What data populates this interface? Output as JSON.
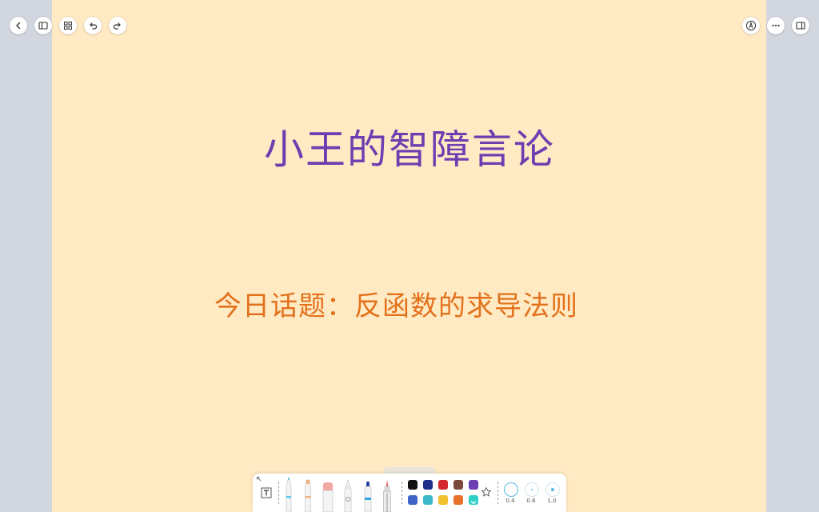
{
  "page": {
    "title": "小王的智障言论",
    "subtitle": "今日话题：反函数的求导法则"
  },
  "top_toolbar": {
    "left": [
      "back-icon",
      "sidebar-icon",
      "grid-icon",
      "undo-icon",
      "redo-icon"
    ],
    "right": [
      "pen-mode-icon",
      "more-icon",
      "panel-icon"
    ]
  },
  "pen_toolbar": {
    "tools": [
      "text-box-icon",
      "pen-icon",
      "highlighter-icon",
      "eraser-icon",
      "lasso-icon",
      "marker-icon",
      "fine-pen-icon"
    ],
    "colors": [
      "#111111",
      "#1c2f8a",
      "#d6262e",
      "#7a4a3a",
      "#6a3fb3",
      "#3f63c8",
      "#3bb8c8",
      "#f2c22e",
      "#e8702a",
      "#2ed0c8"
    ],
    "favorite": "star-icon",
    "sizes": [
      {
        "label": "0.4",
        "value": 0.4
      },
      {
        "label": "0.6",
        "value": 0.6
      },
      {
        "label": "1.0",
        "value": 1.0
      }
    ]
  }
}
